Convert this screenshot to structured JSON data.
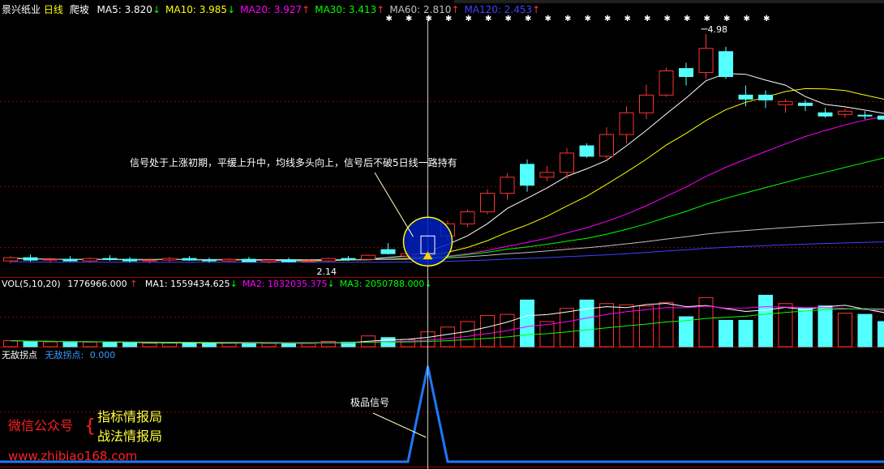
{
  "header": {
    "stock_name": "景兴纸业",
    "period": "日线",
    "indicator": "爬坡",
    "ma": [
      {
        "label": "MA5:",
        "value": "3.820",
        "arrow": "↓",
        "color": "#ffffff"
      },
      {
        "label": "MA10:",
        "value": "3.985",
        "arrow": "↓",
        "color": "#ffff00"
      },
      {
        "label": "MA20:",
        "value": "3.927",
        "arrow": "↑",
        "color": "#ff00ff"
      },
      {
        "label": "MA30:",
        "value": "3.413",
        "arrow": "↑",
        "color": "#00ff00"
      },
      {
        "label": "MA60:",
        "value": "2.810",
        "arrow": "↑",
        "color": "#c0c0c0"
      },
      {
        "label": "MA120:",
        "value": "2.453",
        "arrow": "↑",
        "color": "#4040ff"
      }
    ]
  },
  "volume_header": {
    "label": "VOL(5,10,20)",
    "value": "1776966.000",
    "arrow": "↑",
    "ma": [
      {
        "label": "MA1:",
        "value": "1559434.625",
        "arrow": "↓",
        "color": "#ffffff"
      },
      {
        "label": "MA2:",
        "value": "1832035.375",
        "arrow": "↓",
        "color": "#ff00ff"
      },
      {
        "label": "MA3:",
        "value": "2050788.000",
        "arrow": "↓",
        "color": "#00ff00"
      }
    ]
  },
  "signal_header": {
    "label": "无敌拐点",
    "series_label": "无敌拐点:",
    "value": "0.000"
  },
  "annotations": {
    "main": "信号处于上涨初期，平缓上升中，均线多头向上，信号后不破5日线一路持有",
    "peak_label": "4.98",
    "low_label": "2.14",
    "signal": "极品信号"
  },
  "promo": {
    "prefix": "微信公众号",
    "line1": "指标情报局",
    "line2": "战法情报局",
    "url": "www.zhibiao168.com"
  },
  "colors": {
    "up": "#ff3232",
    "down": "#54ffff",
    "grid": "#800000",
    "signal_line": "#1e78ff",
    "promo_red": "#ff2020",
    "promo_yellow": "#ffff40"
  },
  "chart_data": {
    "type": "candlestick",
    "price_ylim": [
      2.0,
      5.2
    ],
    "candles": [
      {
        "o": 2.16,
        "h": 2.22,
        "l": 2.13,
        "c": 2.2,
        "v": 250000
      },
      {
        "o": 2.2,
        "h": 2.24,
        "l": 2.15,
        "c": 2.17,
        "v": 220000
      },
      {
        "o": 2.17,
        "h": 2.2,
        "l": 2.14,
        "c": 2.18,
        "v": 200000
      },
      {
        "o": 2.18,
        "h": 2.22,
        "l": 2.15,
        "c": 2.16,
        "v": 180000
      },
      {
        "o": 2.16,
        "h": 2.2,
        "l": 2.14,
        "c": 2.19,
        "v": 190000
      },
      {
        "o": 2.19,
        "h": 2.23,
        "l": 2.16,
        "c": 2.18,
        "v": 170000
      },
      {
        "o": 2.18,
        "h": 2.21,
        "l": 2.14,
        "c": 2.16,
        "v": 160000
      },
      {
        "o": 2.16,
        "h": 2.19,
        "l": 2.13,
        "c": 2.17,
        "v": 150000
      },
      {
        "o": 2.17,
        "h": 2.21,
        "l": 2.15,
        "c": 2.19,
        "v": 160000
      },
      {
        "o": 2.19,
        "h": 2.22,
        "l": 2.16,
        "c": 2.17,
        "v": 150000
      },
      {
        "o": 2.17,
        "h": 2.2,
        "l": 2.14,
        "c": 2.16,
        "v": 140000
      },
      {
        "o": 2.16,
        "h": 2.19,
        "l": 2.14,
        "c": 2.18,
        "v": 150000
      },
      {
        "o": 2.18,
        "h": 2.21,
        "l": 2.15,
        "c": 2.15,
        "v": 160000
      },
      {
        "o": 2.15,
        "h": 2.18,
        "l": 2.13,
        "c": 2.17,
        "v": 140000
      },
      {
        "o": 2.17,
        "h": 2.2,
        "l": 2.14,
        "c": 2.15,
        "v": 130000
      },
      {
        "o": 2.15,
        "h": 2.18,
        "l": 2.14,
        "c": 2.16,
        "v": 140000
      },
      {
        "o": 2.16,
        "h": 2.2,
        "l": 2.15,
        "c": 2.19,
        "v": 220000
      },
      {
        "o": 2.19,
        "h": 2.22,
        "l": 2.16,
        "c": 2.18,
        "v": 190000
      },
      {
        "o": 2.18,
        "h": 2.24,
        "l": 2.17,
        "c": 2.23,
        "v": 450000
      },
      {
        "o": 2.3,
        "h": 2.38,
        "l": 2.24,
        "c": 2.25,
        "v": 380000
      },
      {
        "o": 2.22,
        "h": 2.28,
        "l": 2.18,
        "c": 2.25,
        "v": 300000
      },
      {
        "o": 2.25,
        "h": 2.5,
        "l": 2.24,
        "c": 2.47,
        "v": 620000
      },
      {
        "o": 2.47,
        "h": 2.66,
        "l": 2.42,
        "c": 2.62,
        "v": 820000
      },
      {
        "o": 2.62,
        "h": 2.8,
        "l": 2.58,
        "c": 2.77,
        "v": 1050000
      },
      {
        "o": 2.77,
        "h": 3.05,
        "l": 2.74,
        "c": 3.0,
        "v": 1300000
      },
      {
        "o": 3.0,
        "h": 3.25,
        "l": 2.92,
        "c": 3.2,
        "v": 1350000
      },
      {
        "o": 3.36,
        "h": 3.42,
        "l": 3.02,
        "c": 3.1,
        "v": 1950000
      },
      {
        "o": 3.2,
        "h": 3.34,
        "l": 3.15,
        "c": 3.26,
        "v": 1050000
      },
      {
        "o": 3.26,
        "h": 3.56,
        "l": 3.18,
        "c": 3.5,
        "v": 1600000
      },
      {
        "o": 3.59,
        "h": 3.62,
        "l": 3.44,
        "c": 3.46,
        "v": 1950000
      },
      {
        "o": 3.46,
        "h": 3.82,
        "l": 3.43,
        "c": 3.73,
        "v": 1800000
      },
      {
        "o": 3.73,
        "h": 4.08,
        "l": 3.62,
        "c": 4.0,
        "v": 1750000
      },
      {
        "o": 4.0,
        "h": 4.35,
        "l": 3.92,
        "c": 4.22,
        "v": 1700000
      },
      {
        "o": 4.22,
        "h": 4.56,
        "l": 4.2,
        "c": 4.52,
        "v": 1850000
      },
      {
        "o": 4.55,
        "h": 4.62,
        "l": 4.34,
        "c": 4.45,
        "v": 1250000
      },
      {
        "o": 4.5,
        "h": 4.98,
        "l": 4.42,
        "c": 4.8,
        "v": 2050000
      },
      {
        "o": 4.76,
        "h": 4.82,
        "l": 4.42,
        "c": 4.45,
        "v": 1100000
      },
      {
        "o": 4.22,
        "h": 4.34,
        "l": 4.08,
        "c": 4.17,
        "v": 1100000
      },
      {
        "o": 4.22,
        "h": 4.28,
        "l": 4.06,
        "c": 4.16,
        "v": 2150000
      },
      {
        "o": 4.1,
        "h": 4.17,
        "l": 4.0,
        "c": 4.14,
        "v": 1800000
      },
      {
        "o": 4.12,
        "h": 4.16,
        "l": 4.02,
        "c": 4.09,
        "v": 1600000
      },
      {
        "o": 4.0,
        "h": 4.06,
        "l": 3.94,
        "c": 3.96,
        "v": 1700000
      },
      {
        "o": 3.98,
        "h": 4.05,
        "l": 3.94,
        "c": 4.02,
        "v": 1400000
      },
      {
        "o": 3.97,
        "h": 4.02,
        "l": 3.92,
        "c": 3.96,
        "v": 1350000
      },
      {
        "o": 3.96,
        "h": 4.0,
        "l": 3.88,
        "c": 3.92,
        "v": 1050000
      },
      {
        "o": 3.92,
        "h": 3.95,
        "l": 3.68,
        "c": 3.72,
        "v": 1150000
      }
    ],
    "volume_ylim": [
      0,
      2300000
    ],
    "signal": [
      0,
      0,
      0,
      0,
      0,
      0,
      0,
      0,
      0,
      0,
      0,
      0,
      0,
      0,
      0,
      0,
      0,
      0,
      0,
      0,
      0,
      1,
      0,
      0,
      0,
      0,
      0,
      0,
      0,
      0,
      0,
      0,
      0,
      0,
      0,
      0,
      0,
      0,
      0,
      0,
      0,
      0,
      0,
      0,
      0,
      0
    ],
    "signal_index": 21,
    "signal_ylim": [
      0,
      1.05
    ]
  }
}
